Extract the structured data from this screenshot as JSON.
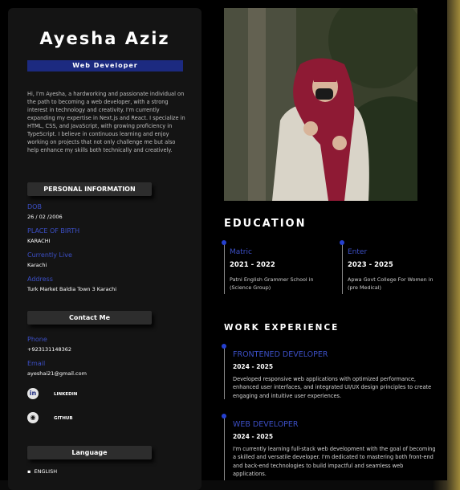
{
  "profile": {
    "name": "Ayesha Aziz",
    "role": "Web Developer",
    "bio": "Hi, I'm Ayesha, a hardworking and passionate individual on the path to becoming a web developer, with a strong interest in technology and creativity. I'm currently expanding my expertise in Next.js and React. I specialize in HTML, CSS, and JavaScript, with growing proficiency in TypeScript. I believe in continuous learning and enjoy working on projects that not only challenge me but also help enhance my skills both technically and creatively."
  },
  "personal": {
    "heading": "PERSONAL INFORMATION",
    "dob_label": "DOB",
    "dob": "26 / 02 /2006",
    "birthplace_label": "PLACE OF BIRTH",
    "birthplace": "KARACHI",
    "live_label": "Currently Live",
    "live": "Karachi",
    "address_label": "Address",
    "address": "Turk Market Baldia Town 3 Karachi"
  },
  "contact": {
    "heading": "Contact Me",
    "phone_label": "Phone",
    "phone": "+923131148362",
    "email_label": "Email",
    "email": "ayeshai21@gmail.com",
    "linkedin": "LINKEDIN",
    "github": "GITHUB",
    "linkedin_icon": "linkedin-icon",
    "github_icon": "github-icon"
  },
  "language": {
    "heading": "Language",
    "items": [
      "ENGLISH"
    ]
  },
  "education": {
    "heading": "EDUCATION",
    "items": [
      {
        "level": "Matric",
        "years": "2021 - 2022",
        "institution": "Patni English Grammer School in (Science Group)"
      },
      {
        "level": "Enter",
        "years": "2023 - 2025",
        "institution": "Apwa Govt College For Women in (pre Medical)"
      }
    ]
  },
  "work": {
    "heading": "WORK EXPERIENCE",
    "items": [
      {
        "title": "FRONTENED DEVELOPER",
        "years": "2024 - 2025",
        "description": "Developed responsive web applications with optimized performance, enhanced user interfaces, and integrated UI/UX design principles to create engaging and intuitive user experiences."
      },
      {
        "title": "WEB DEVELOPER",
        "years": "2024 - 2025",
        "description": "I'm currently learning full-stack web development with the goal of becoming a skilled and versatile developer. I'm dedicated to mastering both front-end and back-end technologies to build impactful and seamless web applications."
      }
    ]
  },
  "colors": {
    "accent": "#3c4fc6",
    "badge": "#1c2a80",
    "sidebar": "#141414",
    "background": "#000000"
  }
}
